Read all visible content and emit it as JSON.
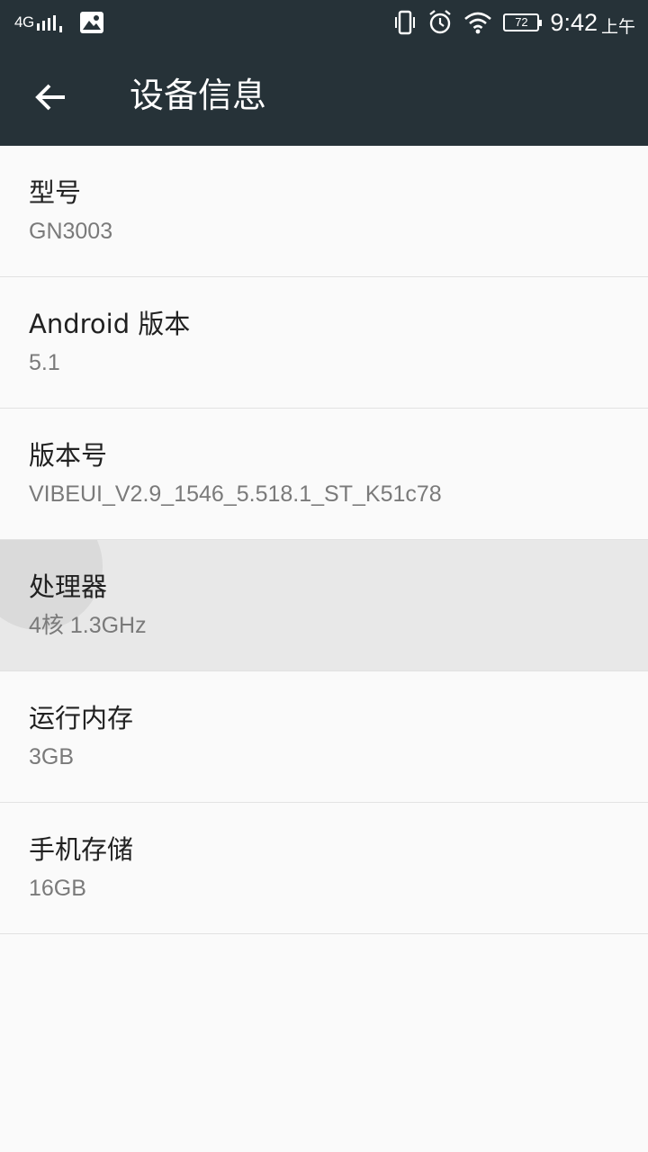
{
  "status_bar": {
    "network": "4G",
    "battery": "72",
    "time": "9:42",
    "ampm": "上午",
    "icons": [
      "signal-icon",
      "image-icon",
      "vibrate-icon",
      "alarm-icon",
      "wifi-icon",
      "battery-icon"
    ]
  },
  "app_bar": {
    "title": "设备信息",
    "back_icon": "arrow-back-icon"
  },
  "items": [
    {
      "title": "型号",
      "value": "GN3003"
    },
    {
      "title": "Android 版本",
      "value": "5.1"
    },
    {
      "title": "版本号",
      "value": "VIBEUI_V2.9_1546_5.518.1_ST_K51c78"
    },
    {
      "title": "处理器",
      "value": "4核 1.3GHz"
    },
    {
      "title": "运行内存",
      "value": "3GB"
    },
    {
      "title": "手机存储",
      "value": "16GB"
    }
  ],
  "colors": {
    "app_bar": "#263238",
    "background": "#fafafa",
    "pressed_row": "#e8e8e8",
    "divider": "#e2e2e2"
  }
}
